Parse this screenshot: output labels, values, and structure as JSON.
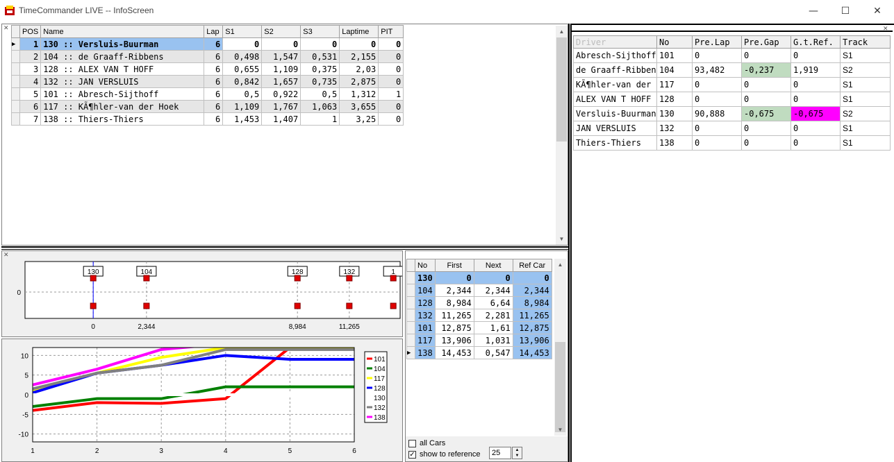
{
  "window": {
    "title": "TimeCommander LIVE -- InfoScreen",
    "minimize": "—",
    "maximize": "☐",
    "close": "✕"
  },
  "standings": {
    "headers": [
      "POS",
      "Name",
      "Lap",
      "S1",
      "S2",
      "S3",
      "Laptime",
      "PIT"
    ],
    "rows": [
      {
        "pos": "1",
        "name": "130  ::  Versluis-Buurman",
        "lap": "6",
        "s1": "0",
        "s2": "0",
        "s3": "0",
        "laptime": "0",
        "pit": "0"
      },
      {
        "pos": "2",
        "name": "104  ::  de Graaff-Ribbens",
        "lap": "6",
        "s1": "0,498",
        "s2": "1,547",
        "s3": "0,531",
        "laptime": "2,155",
        "pit": "0"
      },
      {
        "pos": "3",
        "name": "128  ::  ALEX VAN T HOFF",
        "lap": "6",
        "s1": "0,655",
        "s2": "1,109",
        "s3": "0,375",
        "laptime": "2,03",
        "pit": "0"
      },
      {
        "pos": "4",
        "name": "132  ::  JAN VERSLUIS",
        "lap": "6",
        "s1": "0,842",
        "s2": "1,657",
        "s3": "0,735",
        "laptime": "2,875",
        "pit": "0"
      },
      {
        "pos": "5",
        "name": "101  ::  Abresch-Sijthoff",
        "lap": "6",
        "s1": "0,5",
        "s2": "0,922",
        "s3": "0,5",
        "laptime": "1,312",
        "pit": "1"
      },
      {
        "pos": "6",
        "name": "117  ::  KÃ¶hler-van der Hoek",
        "lap": "6",
        "s1": "1,109",
        "s2": "1,767",
        "s3": "1,063",
        "laptime": "3,655",
        "pit": "0"
      },
      {
        "pos": "7",
        "name": "138  ::  Thiers-Thiers",
        "lap": "6",
        "s1": "1,453",
        "s2": "1,407",
        "s3": "1",
        "laptime": "3,25",
        "pit": "0"
      }
    ]
  },
  "drivers": {
    "headers": [
      "Driver",
      "No",
      "Pre.Lap",
      "Pre.Gap",
      "G.t.Ref.",
      "Track"
    ],
    "rows": [
      {
        "driver": "Abresch-Sijthoff",
        "no": "101",
        "prelap": "0",
        "pregap": "0",
        "gtref": "0",
        "track": "S1",
        "gapColor": "",
        "refColor": ""
      },
      {
        "driver": "de Graaff-Ribbens",
        "no": "104",
        "prelap": "93,482",
        "pregap": "-0,237",
        "gtref": "1,919",
        "track": "S2",
        "gapColor": "#c0dcc0",
        "refColor": ""
      },
      {
        "driver": "KÃ¶hler-van der Hoek",
        "no": "117",
        "prelap": "0",
        "pregap": "0",
        "gtref": "0",
        "track": "S1",
        "gapColor": "",
        "refColor": ""
      },
      {
        "driver": "ALEX VAN T HOFF",
        "no": "128",
        "prelap": "0",
        "pregap": "0",
        "gtref": "0",
        "track": "S1",
        "gapColor": "",
        "refColor": ""
      },
      {
        "driver": "Versluis-Buurman",
        "no": "130",
        "prelap": "90,888",
        "pregap": "-0,675",
        "gtref": "-0,675",
        "track": "S2",
        "gapColor": "#c0dcc0",
        "refColor": "#ff00ff"
      },
      {
        "driver": "JAN VERSLUIS",
        "no": "132",
        "prelap": "0",
        "pregap": "0",
        "gtref": "0",
        "track": "S1",
        "gapColor": "",
        "refColor": ""
      },
      {
        "driver": "Thiers-Thiers",
        "no": "138",
        "prelap": "0",
        "pregap": "0",
        "gtref": "0",
        "track": "S1",
        "gapColor": "",
        "refColor": ""
      }
    ]
  },
  "gaps": {
    "headers": [
      "No",
      "First",
      "Next",
      "Ref Car"
    ],
    "rows": [
      {
        "no": "130",
        "first": "0",
        "next": "0",
        "ref": "0"
      },
      {
        "no": "104",
        "first": "2,344",
        "next": "2,344",
        "ref": "2,344"
      },
      {
        "no": "128",
        "first": "8,984",
        "next": "6,64",
        "ref": "8,984"
      },
      {
        "no": "132",
        "first": "11,265",
        "next": "2,281",
        "ref": "11,265"
      },
      {
        "no": "101",
        "first": "12,875",
        "next": "1,61",
        "ref": "12,875"
      },
      {
        "no": "117",
        "first": "13,906",
        "next": "1,031",
        "ref": "13,906"
      },
      {
        "no": "138",
        "first": "14,453",
        "next": "0,547",
        "ref": "14,453"
      }
    ],
    "options": {
      "all_cars": "all Cars",
      "show_to_reference": "show to reference",
      "count": "25"
    }
  },
  "chart_data": [
    {
      "type": "scatter",
      "title": "",
      "y_tick": "0",
      "x_ticks": [
        "0",
        "2,344",
        "8,984",
        "11,265"
      ],
      "xlim": [
        -3,
        13.5
      ],
      "markers": [
        {
          "label": "130",
          "x": 0
        },
        {
          "label": "104",
          "x": 2.344
        },
        {
          "label": "128",
          "x": 8.984
        },
        {
          "label": "132",
          "x": 11.265
        },
        {
          "label": "1",
          "x": 13.2
        }
      ]
    },
    {
      "type": "line",
      "x": [
        1,
        2,
        3,
        4,
        5,
        6
      ],
      "x_ticks": [
        "1",
        "2",
        "3",
        "4",
        "5",
        "6"
      ],
      "y_ticks": [
        "10",
        "5",
        "0",
        "-5",
        "-10"
      ],
      "ylim": [
        -12,
        12
      ],
      "xlim": [
        1,
        6
      ],
      "series": [
        {
          "name": "101",
          "color": "#ff0000",
          "values": [
            -4,
            -2,
            -2.2,
            -1,
            12,
            12
          ]
        },
        {
          "name": "104",
          "color": "#008000",
          "values": [
            -3,
            -1,
            -1,
            2,
            2,
            2
          ]
        },
        {
          "name": "117",
          "color": "#ffff00",
          "values": [
            1,
            5.5,
            9.5,
            12,
            12,
            12
          ]
        },
        {
          "name": "128",
          "color": "#0000ff",
          "values": [
            0.5,
            5.5,
            7.5,
            10,
            9,
            9
          ]
        },
        {
          "name": "130",
          "color": "#ffffff",
          "values": [
            0,
            0,
            0,
            0,
            0,
            0
          ]
        },
        {
          "name": "132",
          "color": "#808080",
          "values": [
            1.5,
            5.5,
            7.5,
            11.5,
            11.5,
            11.5
          ]
        },
        {
          "name": "138",
          "color": "#ff00ff",
          "values": [
            2.5,
            6.5,
            11.5,
            13,
            13,
            13
          ]
        }
      ]
    }
  ]
}
